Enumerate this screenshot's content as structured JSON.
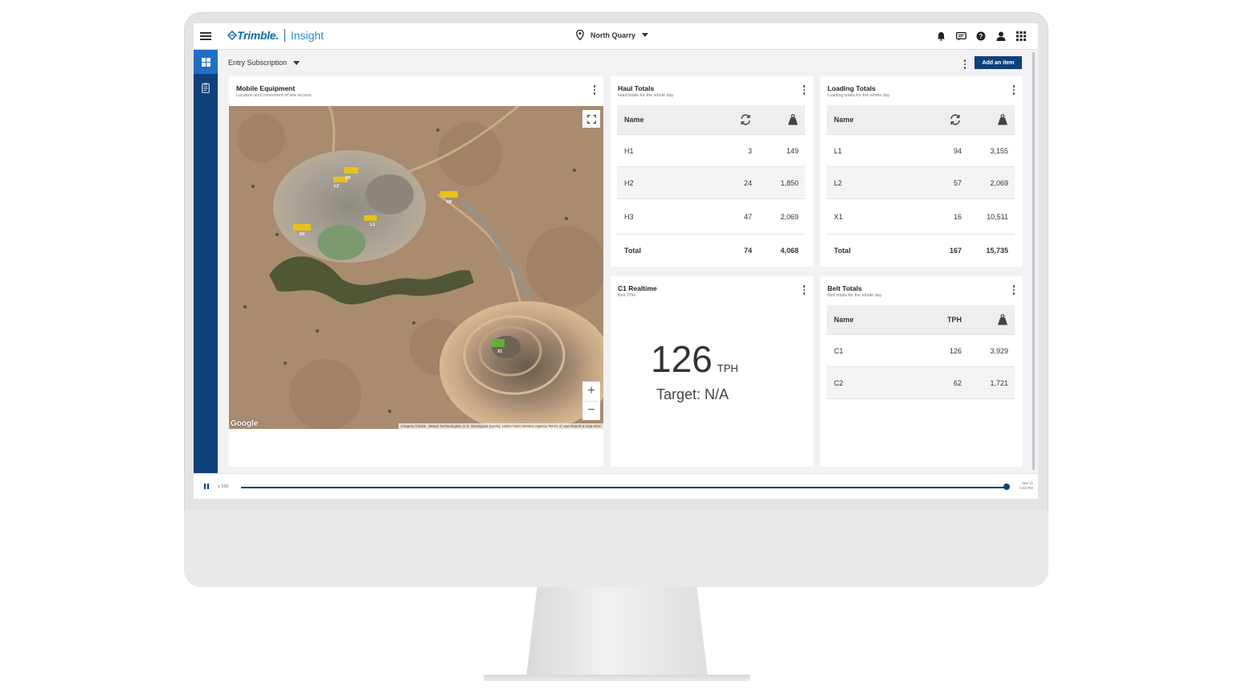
{
  "app": {
    "brand": "Trimble.",
    "product": "Insight"
  },
  "header": {
    "site": "North Quarry"
  },
  "subbar": {
    "subscription": "Entry Subscription",
    "add_button": "Add an item"
  },
  "mobile_equipment": {
    "title": "Mobile Equipment",
    "subtitle": "Location and movement of site access",
    "map_markers": [
      "L2",
      "H3",
      "H2",
      "H1",
      "L1",
      "X1"
    ],
    "google_logo": "Google",
    "attribution": "Imagery ©2021 , Maxar Technologies, U.S. Geological Survey, USDA Farm Service Agency   Terms of Use   Report a map error"
  },
  "haul_totals": {
    "title": "Haul Totals",
    "subtitle": "Haul totals for the whole day",
    "header": "Name",
    "rows": [
      {
        "name": "H1",
        "loads": "3",
        "tons": "149"
      },
      {
        "name": "H2",
        "loads": "24",
        "tons": "1,850"
      },
      {
        "name": "H3",
        "loads": "47",
        "tons": "2,069"
      }
    ],
    "total": {
      "label": "Total",
      "loads": "74",
      "tons": "4,068"
    }
  },
  "loading_totals": {
    "title": "Loading Totals",
    "subtitle": "Loading totals for the whole day",
    "header": "Name",
    "rows": [
      {
        "name": "L1",
        "loads": "94",
        "tons": "3,155"
      },
      {
        "name": "L2",
        "loads": "57",
        "tons": "2,069"
      },
      {
        "name": "X1",
        "loads": "16",
        "tons": "10,511"
      }
    ],
    "total": {
      "label": "Total",
      "loads": "167",
      "tons": "15,735"
    }
  },
  "c1_realtime": {
    "title": "C1 Realtime",
    "subtitle": "Belt TPH",
    "value": "126",
    "unit": "TPH",
    "target": "Target: N/A"
  },
  "belt_totals": {
    "title": "Belt Totals",
    "subtitle": "Belt totals for the whole day",
    "header_name": "Name",
    "header_tph": "TPH",
    "rows": [
      {
        "name": "C1",
        "tph": "126",
        "tons": "3,929"
      },
      {
        "name": "C2",
        "tph": "62",
        "tons": "1,721"
      }
    ]
  },
  "timeline": {
    "speed": "x 100",
    "date": "Mar 11",
    "time": "5:53 PM",
    "progress": 1.0
  },
  "colors": {
    "nav": "#0e417a",
    "nav_selected": "#1f6fc4",
    "brand": "#0d6aad"
  }
}
